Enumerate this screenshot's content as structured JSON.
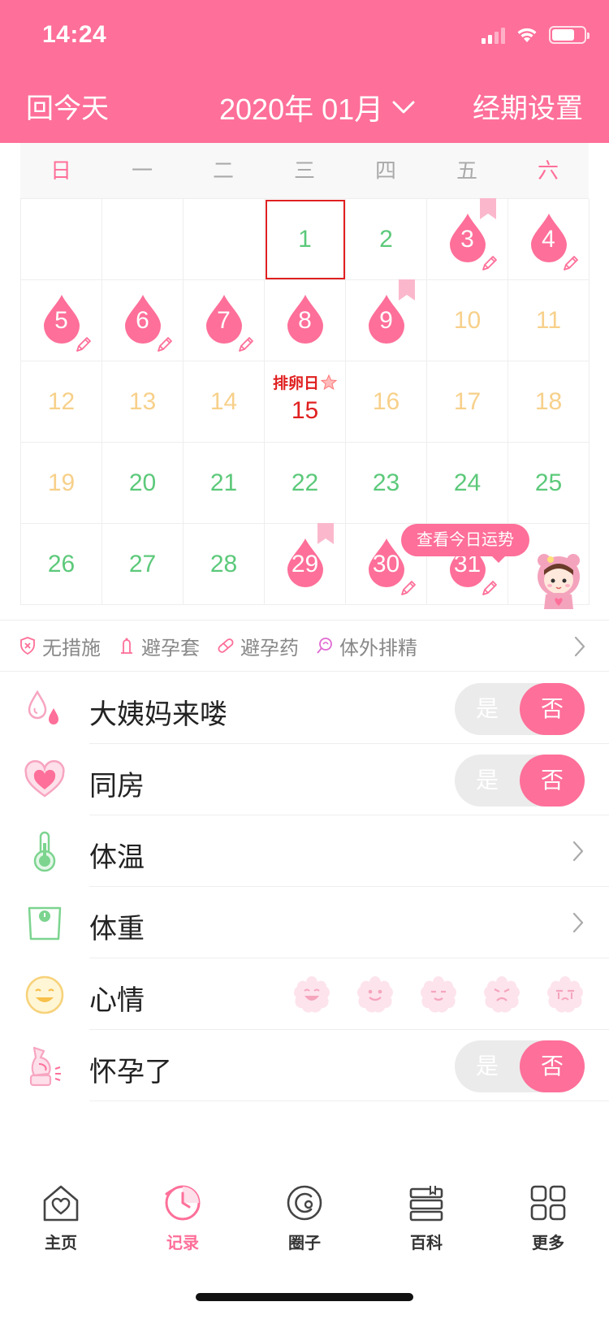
{
  "status_bar": {
    "time": "14:24"
  },
  "header": {
    "today_button": "回今天",
    "month": "2020年 01月",
    "settings_button": "经期设置"
  },
  "colors": {
    "accent": "#fe6f99",
    "green": "#5cc97a",
    "yellow": "#f7d08a",
    "red": "#e02020"
  },
  "calendar": {
    "weekdays": [
      "日",
      "一",
      "二",
      "三",
      "四",
      "五",
      "六"
    ],
    "ovulation_label": "排卵日",
    "fortune_button": "查看今日运势",
    "days": [
      {
        "day": ""
      },
      {
        "day": ""
      },
      {
        "day": ""
      },
      {
        "day": "1",
        "color": "green",
        "today": true
      },
      {
        "day": "2",
        "color": "green"
      },
      {
        "day": "3",
        "period": true,
        "pencil": true,
        "ribbon": true
      },
      {
        "day": "4",
        "period": true,
        "pencil": true
      },
      {
        "day": "5",
        "period": true,
        "pencil": true
      },
      {
        "day": "6",
        "period": true,
        "pencil": true
      },
      {
        "day": "7",
        "period": true,
        "pencil": true
      },
      {
        "day": "8",
        "period": true
      },
      {
        "day": "9",
        "period": true,
        "ribbon": true
      },
      {
        "day": "10",
        "color": "yellow"
      },
      {
        "day": "11",
        "color": "yellow"
      },
      {
        "day": "12",
        "color": "yellow"
      },
      {
        "day": "13",
        "color": "yellow"
      },
      {
        "day": "14",
        "color": "yellow"
      },
      {
        "day": "15",
        "color": "red",
        "ovulation": true
      },
      {
        "day": "16",
        "color": "yellow"
      },
      {
        "day": "17",
        "color": "yellow"
      },
      {
        "day": "18",
        "color": "yellow"
      },
      {
        "day": "19",
        "color": "yellow"
      },
      {
        "day": "20",
        "color": "green"
      },
      {
        "day": "21",
        "color": "green"
      },
      {
        "day": "22",
        "color": "green"
      },
      {
        "day": "23",
        "color": "green"
      },
      {
        "day": "24",
        "color": "green"
      },
      {
        "day": "25",
        "color": "green"
      },
      {
        "day": "26",
        "color": "green"
      },
      {
        "day": "27",
        "color": "green"
      },
      {
        "day": "28",
        "color": "green"
      },
      {
        "day": "29",
        "period": true,
        "ribbon": true
      },
      {
        "day": "30",
        "period": true,
        "pencil": true
      },
      {
        "day": "31",
        "period": true,
        "pencil": true
      },
      {
        "day": ""
      }
    ]
  },
  "contraception": {
    "items": [
      {
        "label": "无措施",
        "icon": "shield-x-icon"
      },
      {
        "label": "避孕套",
        "icon": "condom-icon"
      },
      {
        "label": "避孕药",
        "icon": "pill-icon"
      },
      {
        "label": "体外排精",
        "icon": "withdrawal-icon"
      }
    ]
  },
  "records": {
    "period": {
      "label": "大姨妈来喽",
      "yes": "是",
      "no": "否",
      "selected": "否"
    },
    "intimacy": {
      "label": "同房",
      "yes": "是",
      "no": "否",
      "selected": "否"
    },
    "temperature": {
      "label": "体温"
    },
    "weight": {
      "label": "体重"
    },
    "mood": {
      "label": "心情",
      "options": [
        "very-happy",
        "happy",
        "smile",
        "sad",
        "crying"
      ]
    },
    "pregnant": {
      "label": "怀孕了",
      "yes": "是",
      "no": "否",
      "selected": "否"
    }
  },
  "tabbar": {
    "tabs": [
      {
        "label": "主页",
        "icon": "home-heart-icon"
      },
      {
        "label": "记录",
        "icon": "clock-record-icon",
        "active": true
      },
      {
        "label": "圈子",
        "icon": "community-icon"
      },
      {
        "label": "百科",
        "icon": "books-icon"
      },
      {
        "label": "更多",
        "icon": "grid-more-icon"
      }
    ]
  }
}
